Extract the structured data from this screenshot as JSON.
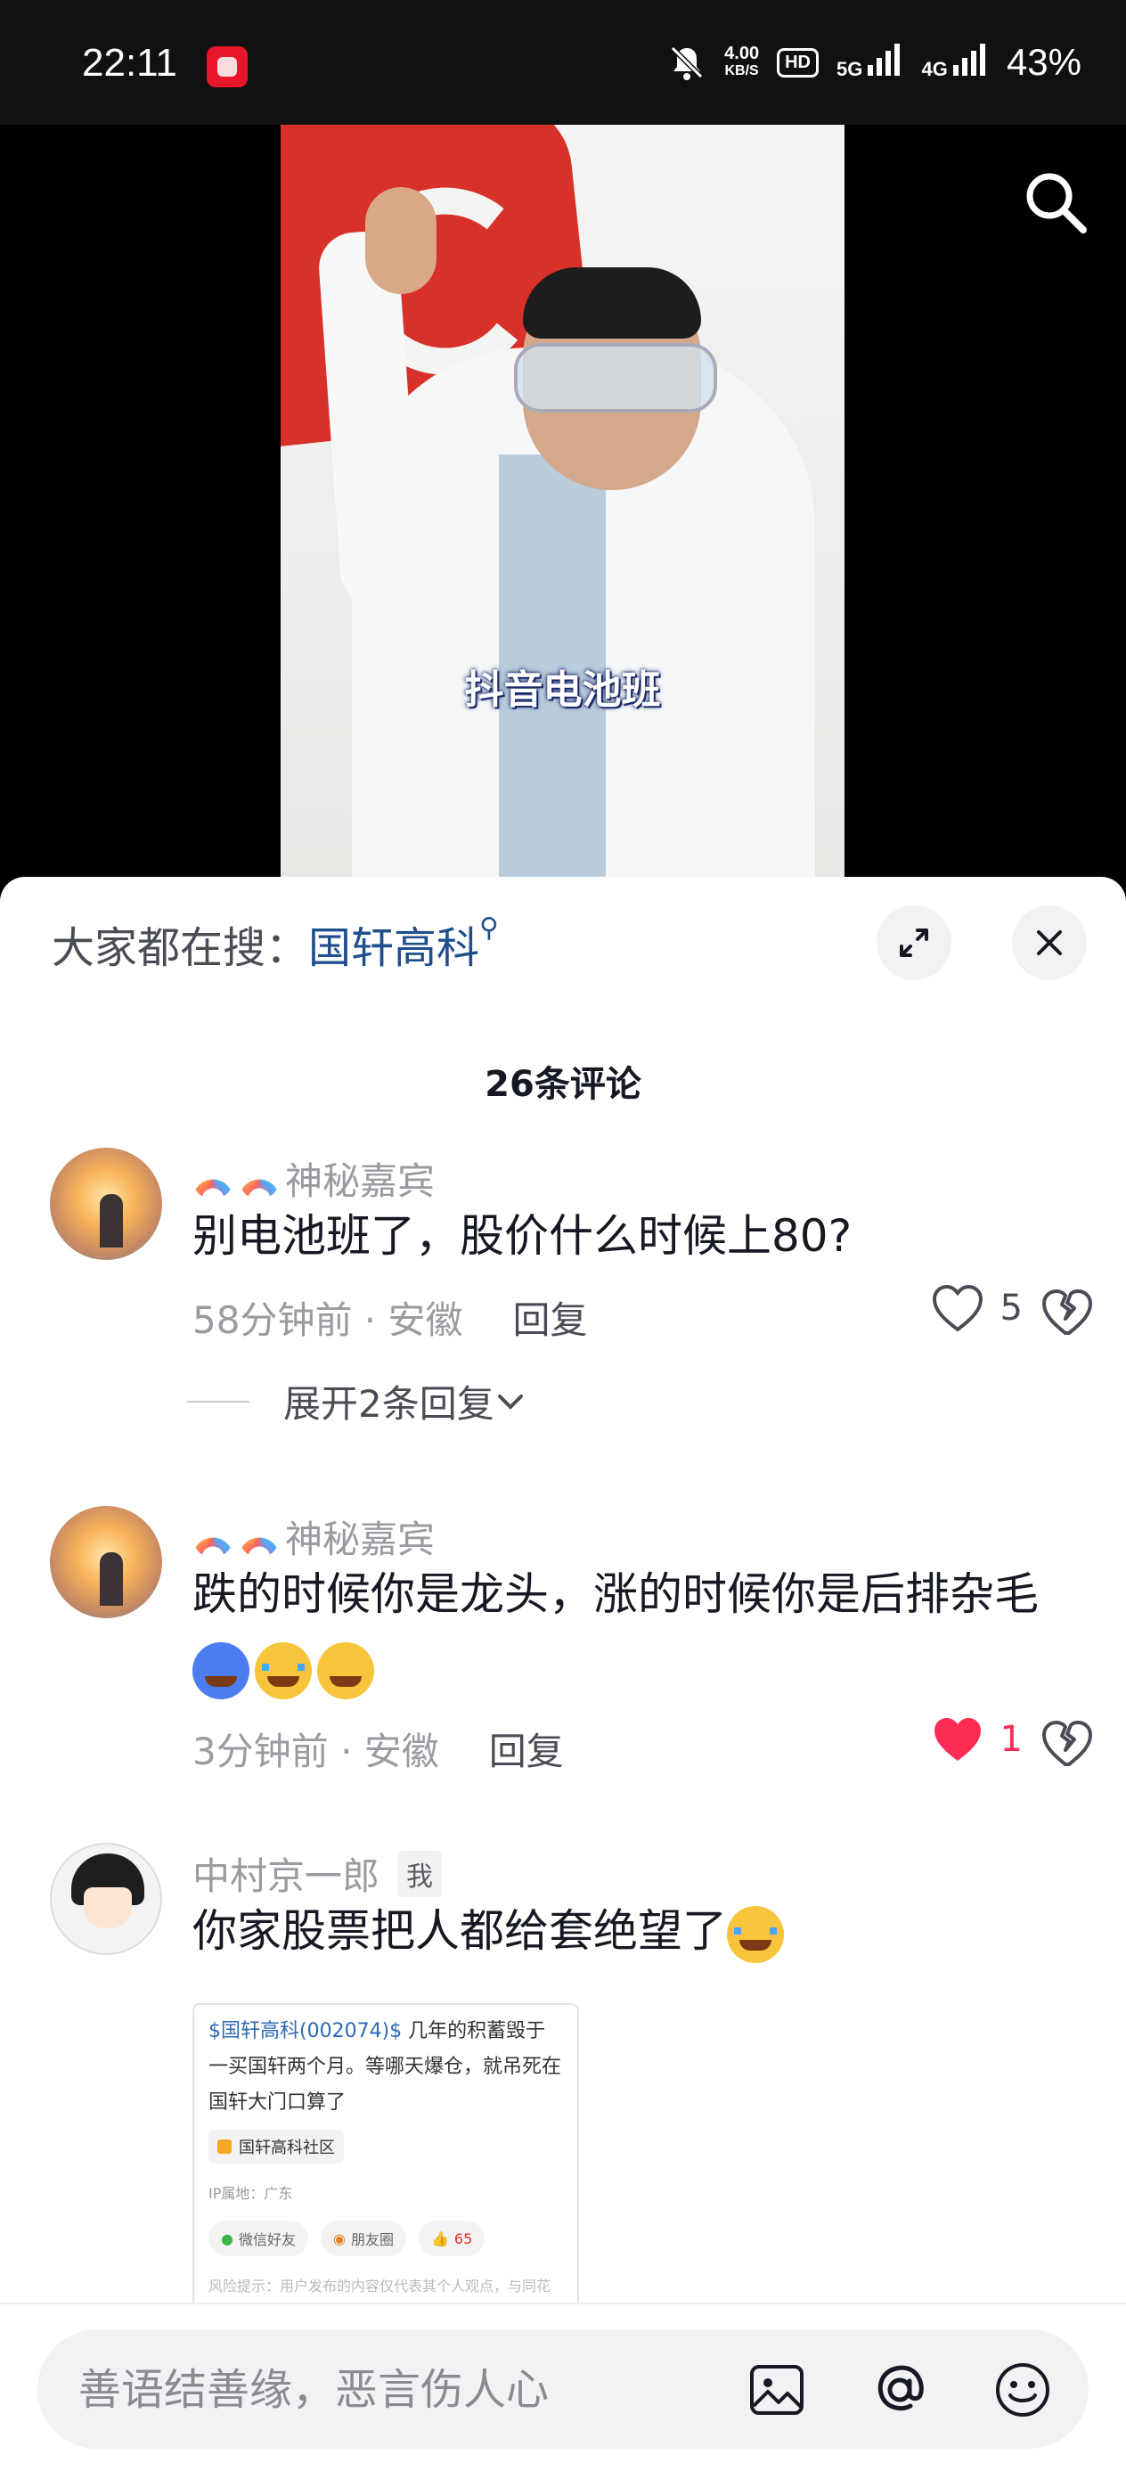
{
  "status_bar": {
    "time": "22:11",
    "net_speed_value": "4.00",
    "net_speed_unit": "KB/S",
    "hd_label": "HD",
    "net5g_label": "5G",
    "net4g_label": "4G",
    "battery": "43%",
    "app_icon": "red-app-notification-icon"
  },
  "video": {
    "caption": "抖音电池班"
  },
  "sheet": {
    "hot_search_prefix": "大家都在搜：",
    "hot_search_term": "国轩高科",
    "comment_count": "26条评论"
  },
  "comments": [
    {
      "user": "神秘嘉宾",
      "text": "别电池班了，股价什么时候上80?",
      "time_location": "58分钟前 · 安徽",
      "reply_label": "回复",
      "likes": "5",
      "liked": false,
      "expand_label": "展开2条回复"
    },
    {
      "user": "神秘嘉宾",
      "text": "跌的时候你是龙头，涨的时候你是后排杂毛",
      "emojis": [
        "freezing-face",
        "loudly-crying-face",
        "sweat-grin-face"
      ],
      "time_location": "3分钟前 · 安徽",
      "reply_label": "回复",
      "likes": "1",
      "liked": true
    },
    {
      "user": "中村京一郎",
      "me_tag": "我",
      "text": "你家股票把人都给套绝望了",
      "emojis": [
        "laughing-crying-face"
      ],
      "embed": {
        "stock_link": "$国轩高科(002074)$",
        "text": " 几年的积蓄毁于一买国轩两个月。等哪天爆仓，就吊死在国轩大门口算了",
        "community": "国轩高科社区",
        "ip": "IP属地：广东",
        "share_wechat": "微信好友",
        "share_moments": "朋友圈",
        "like_count": "65",
        "risk": "风险提示：用户发布的内容仅代表其个人观点，与同花"
      }
    }
  ],
  "input": {
    "placeholder": "善语结善缘，恶言伤人心"
  },
  "colors": {
    "accent_link": "#1f4e8c",
    "like_red": "#fe2c55",
    "text_primary": "#161823",
    "text_secondary": "#9a9ba0"
  }
}
